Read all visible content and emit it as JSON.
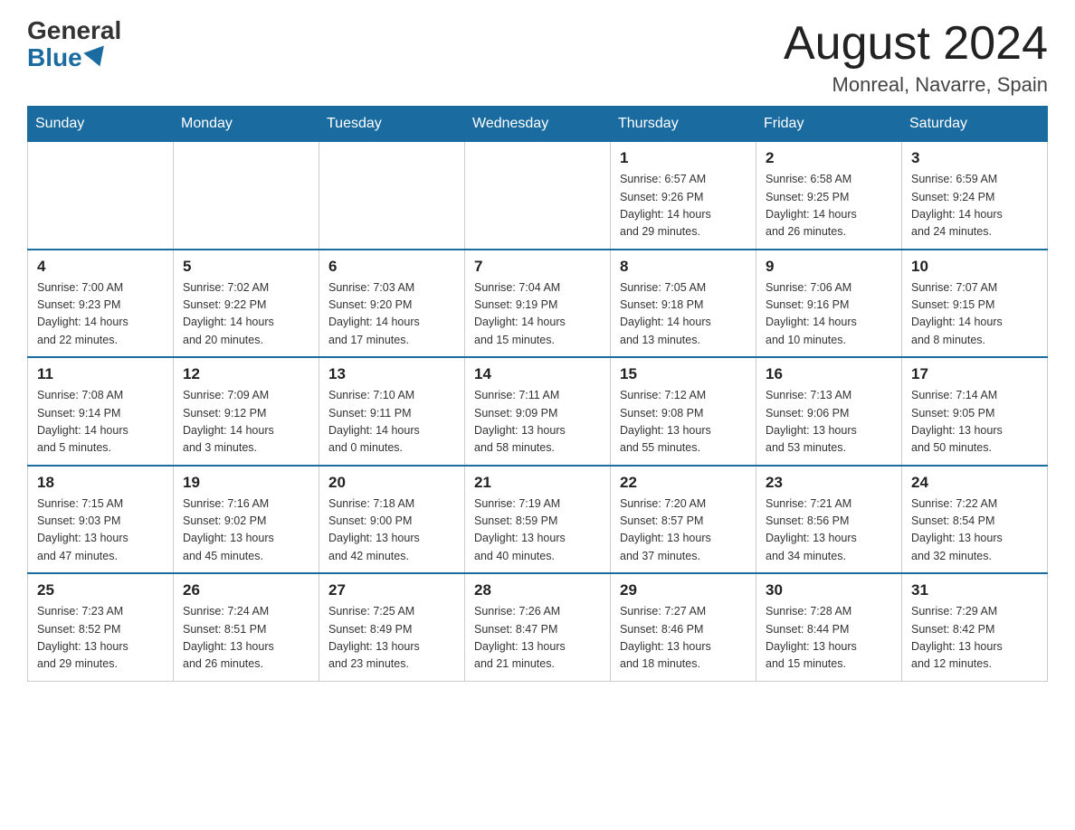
{
  "logo": {
    "general": "General",
    "blue": "Blue"
  },
  "header": {
    "title": "August 2024",
    "subtitle": "Monreal, Navarre, Spain"
  },
  "days_of_week": [
    "Sunday",
    "Monday",
    "Tuesday",
    "Wednesday",
    "Thursday",
    "Friday",
    "Saturday"
  ],
  "weeks": [
    [
      {
        "day": "",
        "info": ""
      },
      {
        "day": "",
        "info": ""
      },
      {
        "day": "",
        "info": ""
      },
      {
        "day": "",
        "info": ""
      },
      {
        "day": "1",
        "info": "Sunrise: 6:57 AM\nSunset: 9:26 PM\nDaylight: 14 hours\nand 29 minutes."
      },
      {
        "day": "2",
        "info": "Sunrise: 6:58 AM\nSunset: 9:25 PM\nDaylight: 14 hours\nand 26 minutes."
      },
      {
        "day": "3",
        "info": "Sunrise: 6:59 AM\nSunset: 9:24 PM\nDaylight: 14 hours\nand 24 minutes."
      }
    ],
    [
      {
        "day": "4",
        "info": "Sunrise: 7:00 AM\nSunset: 9:23 PM\nDaylight: 14 hours\nand 22 minutes."
      },
      {
        "day": "5",
        "info": "Sunrise: 7:02 AM\nSunset: 9:22 PM\nDaylight: 14 hours\nand 20 minutes."
      },
      {
        "day": "6",
        "info": "Sunrise: 7:03 AM\nSunset: 9:20 PM\nDaylight: 14 hours\nand 17 minutes."
      },
      {
        "day": "7",
        "info": "Sunrise: 7:04 AM\nSunset: 9:19 PM\nDaylight: 14 hours\nand 15 minutes."
      },
      {
        "day": "8",
        "info": "Sunrise: 7:05 AM\nSunset: 9:18 PM\nDaylight: 14 hours\nand 13 minutes."
      },
      {
        "day": "9",
        "info": "Sunrise: 7:06 AM\nSunset: 9:16 PM\nDaylight: 14 hours\nand 10 minutes."
      },
      {
        "day": "10",
        "info": "Sunrise: 7:07 AM\nSunset: 9:15 PM\nDaylight: 14 hours\nand 8 minutes."
      }
    ],
    [
      {
        "day": "11",
        "info": "Sunrise: 7:08 AM\nSunset: 9:14 PM\nDaylight: 14 hours\nand 5 minutes."
      },
      {
        "day": "12",
        "info": "Sunrise: 7:09 AM\nSunset: 9:12 PM\nDaylight: 14 hours\nand 3 minutes."
      },
      {
        "day": "13",
        "info": "Sunrise: 7:10 AM\nSunset: 9:11 PM\nDaylight: 14 hours\nand 0 minutes."
      },
      {
        "day": "14",
        "info": "Sunrise: 7:11 AM\nSunset: 9:09 PM\nDaylight: 13 hours\nand 58 minutes."
      },
      {
        "day": "15",
        "info": "Sunrise: 7:12 AM\nSunset: 9:08 PM\nDaylight: 13 hours\nand 55 minutes."
      },
      {
        "day": "16",
        "info": "Sunrise: 7:13 AM\nSunset: 9:06 PM\nDaylight: 13 hours\nand 53 minutes."
      },
      {
        "day": "17",
        "info": "Sunrise: 7:14 AM\nSunset: 9:05 PM\nDaylight: 13 hours\nand 50 minutes."
      }
    ],
    [
      {
        "day": "18",
        "info": "Sunrise: 7:15 AM\nSunset: 9:03 PM\nDaylight: 13 hours\nand 47 minutes."
      },
      {
        "day": "19",
        "info": "Sunrise: 7:16 AM\nSunset: 9:02 PM\nDaylight: 13 hours\nand 45 minutes."
      },
      {
        "day": "20",
        "info": "Sunrise: 7:18 AM\nSunset: 9:00 PM\nDaylight: 13 hours\nand 42 minutes."
      },
      {
        "day": "21",
        "info": "Sunrise: 7:19 AM\nSunset: 8:59 PM\nDaylight: 13 hours\nand 40 minutes."
      },
      {
        "day": "22",
        "info": "Sunrise: 7:20 AM\nSunset: 8:57 PM\nDaylight: 13 hours\nand 37 minutes."
      },
      {
        "day": "23",
        "info": "Sunrise: 7:21 AM\nSunset: 8:56 PM\nDaylight: 13 hours\nand 34 minutes."
      },
      {
        "day": "24",
        "info": "Sunrise: 7:22 AM\nSunset: 8:54 PM\nDaylight: 13 hours\nand 32 minutes."
      }
    ],
    [
      {
        "day": "25",
        "info": "Sunrise: 7:23 AM\nSunset: 8:52 PM\nDaylight: 13 hours\nand 29 minutes."
      },
      {
        "day": "26",
        "info": "Sunrise: 7:24 AM\nSunset: 8:51 PM\nDaylight: 13 hours\nand 26 minutes."
      },
      {
        "day": "27",
        "info": "Sunrise: 7:25 AM\nSunset: 8:49 PM\nDaylight: 13 hours\nand 23 minutes."
      },
      {
        "day": "28",
        "info": "Sunrise: 7:26 AM\nSunset: 8:47 PM\nDaylight: 13 hours\nand 21 minutes."
      },
      {
        "day": "29",
        "info": "Sunrise: 7:27 AM\nSunset: 8:46 PM\nDaylight: 13 hours\nand 18 minutes."
      },
      {
        "day": "30",
        "info": "Sunrise: 7:28 AM\nSunset: 8:44 PM\nDaylight: 13 hours\nand 15 minutes."
      },
      {
        "day": "31",
        "info": "Sunrise: 7:29 AM\nSunset: 8:42 PM\nDaylight: 13 hours\nand 12 minutes."
      }
    ]
  ]
}
